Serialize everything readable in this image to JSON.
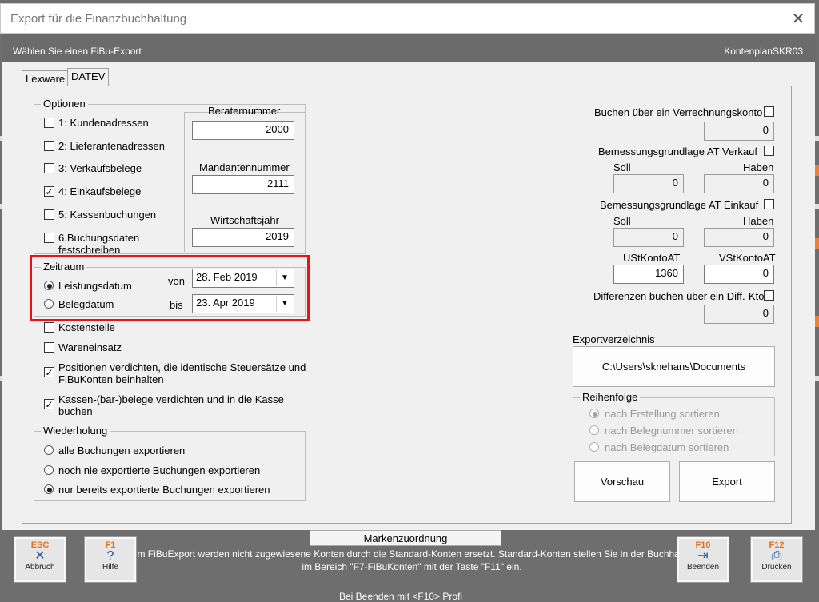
{
  "window": {
    "title": "Export für die Finanzbuchhaltung",
    "close_glyph": "✕",
    "header_left": "Wählen Sie einen FiBu-Export",
    "header_right": "KontenplanSKR03"
  },
  "tabs": [
    {
      "label": "Lexware",
      "active": false
    },
    {
      "label": "DATEV",
      "active": true
    }
  ],
  "optionen": {
    "title": "Optionen",
    "items": [
      {
        "label": "1: Kundenadressen",
        "checked": false
      },
      {
        "label": "2: Lieferantenadressen",
        "checked": false
      },
      {
        "label": "3: Verkaufsbelege",
        "checked": false
      },
      {
        "label": "4: Einkaufsbelege",
        "checked": true
      },
      {
        "label": "5: Kassenbuchungen",
        "checked": false
      },
      {
        "label": "6.Buchungsdaten festschreiben",
        "checked": false
      }
    ]
  },
  "berater": {
    "beraternummer_label": "Beraternummer",
    "beraternummer": "2000",
    "mandanten_label": "Mandantennummer",
    "mandanten": "2111",
    "wj_label": "Wirtschaftsjahr",
    "wj": "2019"
  },
  "zeitraum": {
    "title": "Zeitraum",
    "leistungsdatum": "Leistungsdatum",
    "leistungsdatum_selected": true,
    "belegdatum": "Belegdatum",
    "belegdatum_selected": false,
    "von_label": "von",
    "von_value": "28. Feb 2019",
    "bis_label": "bis",
    "bis_value": "23. Apr 2019",
    "dropdown_glyph": "▼"
  },
  "extra_options": [
    {
      "label": "Kostenstelle",
      "checked": false
    },
    {
      "label": "Wareneinsatz",
      "checked": false
    },
    {
      "label": "Positionen verdichten, die identische Steuersätze und FiBuKonten beinhalten",
      "checked": true
    },
    {
      "label": "Kassen-(bar-)belege verdichten und in die Kasse buchen",
      "checked": true
    }
  ],
  "wiederholung": {
    "title": "Wiederholung",
    "options": [
      {
        "label": "alle Buchungen exportieren",
        "selected": false
      },
      {
        "label": "noch nie exportierte Buchungen exportieren",
        "selected": false
      },
      {
        "label": "nur bereits exportierte Buchungen exportieren",
        "selected": true
      }
    ]
  },
  "right": {
    "verrechnung_label": "Buchen über ein Verrechnungskonto",
    "verrechnung_value": "0",
    "bem_verkauf_label": "Bemessungsgrundlage AT Verkauf",
    "soll": "Soll",
    "haben": "Haben",
    "bem_verkauf_soll": "0",
    "bem_verkauf_haben": "0",
    "bem_einkauf_label": "Bemessungsgrundlage AT Einkauf",
    "bem_einkauf_soll": "0",
    "bem_einkauf_haben": "0",
    "ust_label": "UStKontoAT",
    "ust_value": "1360",
    "vst_label": "VStKontoAT",
    "vst_value": "0",
    "diff_label": "Differenzen buchen über ein Diff.-Kto.",
    "diff_value": "0",
    "exportverzeichnis_label": "Exportverzeichnis",
    "exportverzeichnis_path": "C:\\Users\\sknehans\\Documents"
  },
  "reihenfolge": {
    "title": "Reihenfolge",
    "options": [
      {
        "label": "nach Erstellung sortieren",
        "selected": true
      },
      {
        "label": "nach Belegnummer sortieren",
        "selected": false
      },
      {
        "label": "nach Belegdatum sortieren",
        "selected": false
      }
    ]
  },
  "buttons": {
    "vorschau": "Vorschau",
    "export": "Export"
  },
  "bottom": {
    "marken": "Markenzuordnung",
    "info": "Beim FiBuExport werden nicht zugewiesene Konten durch die Standard-Konten ersetzt. Standard-Konten stellen Sie in der Buchhaltung im Bereich \"F7-FiBuKonten\" mit der Taste \"F11\" ein.",
    "footer": "Bei Beenden mit <F10> Profi",
    "keys": [
      {
        "key": "ESC",
        "icon": "✕",
        "label": "Abbruch"
      },
      {
        "key": "F1",
        "icon": "?",
        "label": "Hilfe"
      },
      {
        "key": "F10",
        "icon": "⇥",
        "label": "Beenden"
      },
      {
        "key": "F12",
        "icon": "⎙",
        "label": "Drucken"
      }
    ]
  }
}
